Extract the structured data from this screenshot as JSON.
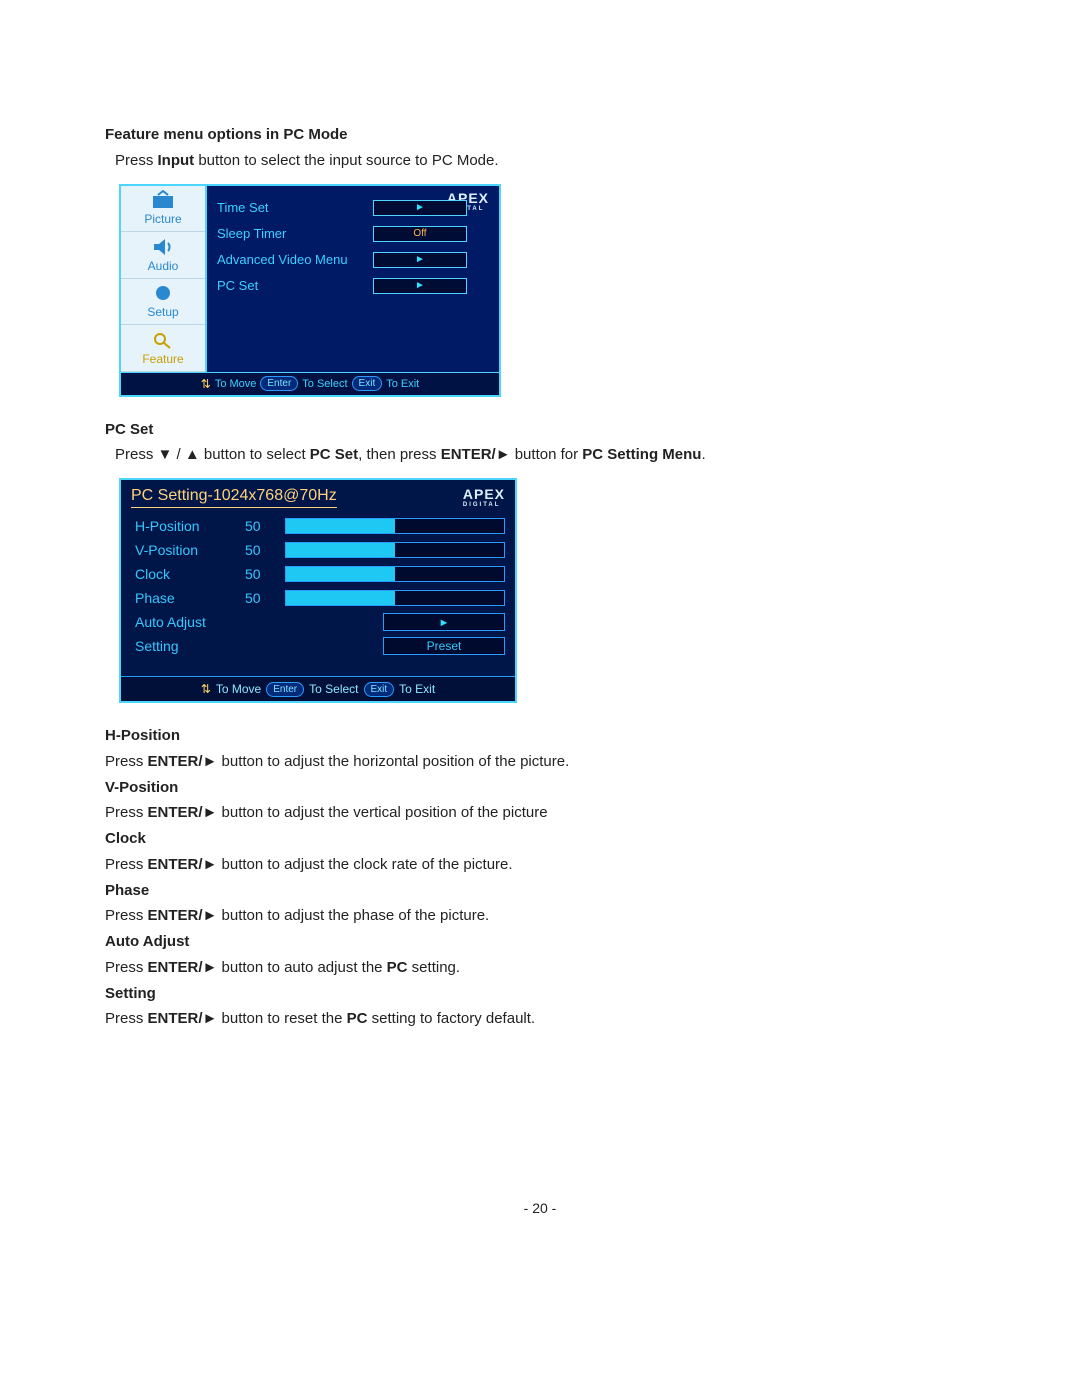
{
  "heading1": "Feature menu options in PC Mode",
  "intro1_a": "Press ",
  "intro1_b": "Input",
  "intro1_c": " button to select the input source to PC Mode.",
  "osd1": {
    "brand": "APEX",
    "brand_sub": "DIGITAL",
    "side": {
      "picture": "Picture",
      "audio": "Audio",
      "setup": "Setup",
      "feature": "Feature"
    },
    "rows": {
      "time_set": "Time Set",
      "sleep_timer": "Sleep Timer",
      "sleep_timer_val": "Off",
      "adv_video": "Advanced Video Menu",
      "pc_set": "PC Set"
    },
    "footer": {
      "move": "To Move",
      "enter": "Enter",
      "select": "To Select",
      "exit": "Exit",
      "toexit": "To Exit"
    }
  },
  "heading2": "PC Set",
  "pcset_a": "Press ▼ / ▲ button to select ",
  "pcset_b": "PC Set",
  "pcset_c": ", then press ",
  "pcset_d": "ENTER/►",
  "pcset_e": " button for ",
  "pcset_f": "PC Setting Menu",
  "pcset_g": ".",
  "osd2": {
    "title": "PC Setting-1024x768@70Hz",
    "brand": "APEX",
    "brand_sub": "DIGITAL",
    "rows": {
      "hpos": {
        "label": "H-Position",
        "val": "50"
      },
      "vpos": {
        "label": "V-Position",
        "val": "50"
      },
      "clock": {
        "label": "Clock",
        "val": "50"
      },
      "phase": {
        "label": "Phase",
        "val": "50"
      },
      "auto": {
        "label": "Auto Adjust"
      },
      "setting": {
        "label": "Setting",
        "val": "Preset"
      }
    },
    "footer": {
      "move": "To Move",
      "enter": "Enter",
      "select": "To Select",
      "exit": "Exit",
      "toexit": "To Exit"
    }
  },
  "defs": {
    "hpos_h": "H-Position",
    "hpos_t1": "Press ",
    "hpos_t2": "ENTER/►",
    "hpos_t3": " button to adjust the horizontal position of the picture.",
    "vpos_h": "V-Position",
    "vpos_t1": "Press ",
    "vpos_t2": "ENTER/►",
    "vpos_t3": " button to adjust the vertical position of the picture",
    "clock_h": "Clock",
    "clock_t1": "Press ",
    "clock_t2": "ENTER/►",
    "clock_t3": " button to adjust the clock rate of the picture.",
    "phase_h": "Phase",
    "phase_t1": "Press ",
    "phase_t2": "ENTER/►",
    "phase_t3": " button to adjust the phase of the picture.",
    "auto_h": "Auto Adjust",
    "auto_t1": "Press ",
    "auto_t2": "ENTER/►",
    "auto_t3": " button to auto adjust the ",
    "auto_t4": "PC",
    "auto_t5": " setting.",
    "set_h": "Setting",
    "set_t1": "Press ",
    "set_t2": "ENTER/►",
    "set_t3": " button to reset the ",
    "set_t4": "PC",
    "set_t5": " setting to factory default."
  },
  "page_number": "- 20 -"
}
